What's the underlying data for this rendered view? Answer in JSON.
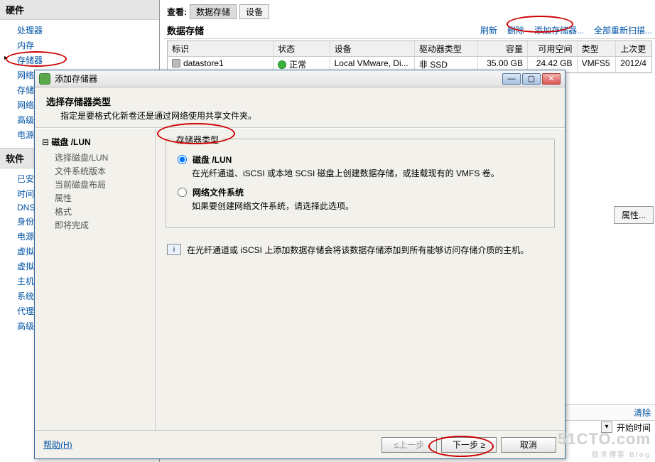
{
  "left": {
    "section1_title": "硬件",
    "section1_items": [
      "处理器",
      "内存",
      "存储器",
      "网络",
      "存储",
      "网络",
      "高级",
      "电源"
    ],
    "section2_title": "软件",
    "section2_items": [
      "已安",
      "时间",
      "DNS",
      "身份",
      "电源",
      "虚拟",
      "虚拟",
      "主机",
      "系统",
      "代理",
      "高级"
    ]
  },
  "main": {
    "view_label": "查看:",
    "tab_datastore": "数据存储",
    "tab_device": "设备",
    "section_title": "数据存储",
    "actions": {
      "refresh": "刷新",
      "delete": "删除",
      "add": "添加存储器...",
      "rescan": "全部重新扫描..."
    },
    "columns": [
      "标识",
      "状态",
      "设备",
      "驱动器类型",
      "容量",
      "可用空间",
      "类型",
      "上次更"
    ],
    "row": {
      "id": "datastore1",
      "status": "正常",
      "device": "Local VMware, Di...",
      "drive": "非 SSD",
      "capacity": "35.00 GB",
      "free": "24.42 GB",
      "type": "VMFS5",
      "updated": "2012/4"
    },
    "props_btn": "属性...",
    "clear": "清除",
    "start_time": "开始时间"
  },
  "dialog": {
    "title": "添加存储器",
    "head_title": "选择存储器类型",
    "head_sub": "指定是要格式化新卷还是通过网络使用共享文件夹。",
    "tree_root": "磁盘 /LUN",
    "tree_items": [
      "选择磁盘/LUN",
      "文件系统版本",
      "当前磁盘布局",
      "属性",
      "格式",
      "即将完成"
    ],
    "group_legend": "存储器类型",
    "opt1_label": "磁盘 /LUN",
    "opt1_desc": "在光纤通道、iSCSI 或本地 SCSI 磁盘上创建数据存储，或挂载现有的 VMFS 卷。",
    "opt2_label": "网络文件系统",
    "opt2_desc": "如果要创建网络文件系统，请选择此选项。",
    "hint": "在光纤通道或 iSCSI 上添加数据存储会将该数据存储添加到所有能够访问存储介质的主机。",
    "help": "帮助(H)",
    "back": "≤上一步",
    "next": "下一步 ≥",
    "cancel": "取消"
  },
  "watermark": {
    "big": "51CTO.com",
    "small": "技术博客  Blog"
  }
}
